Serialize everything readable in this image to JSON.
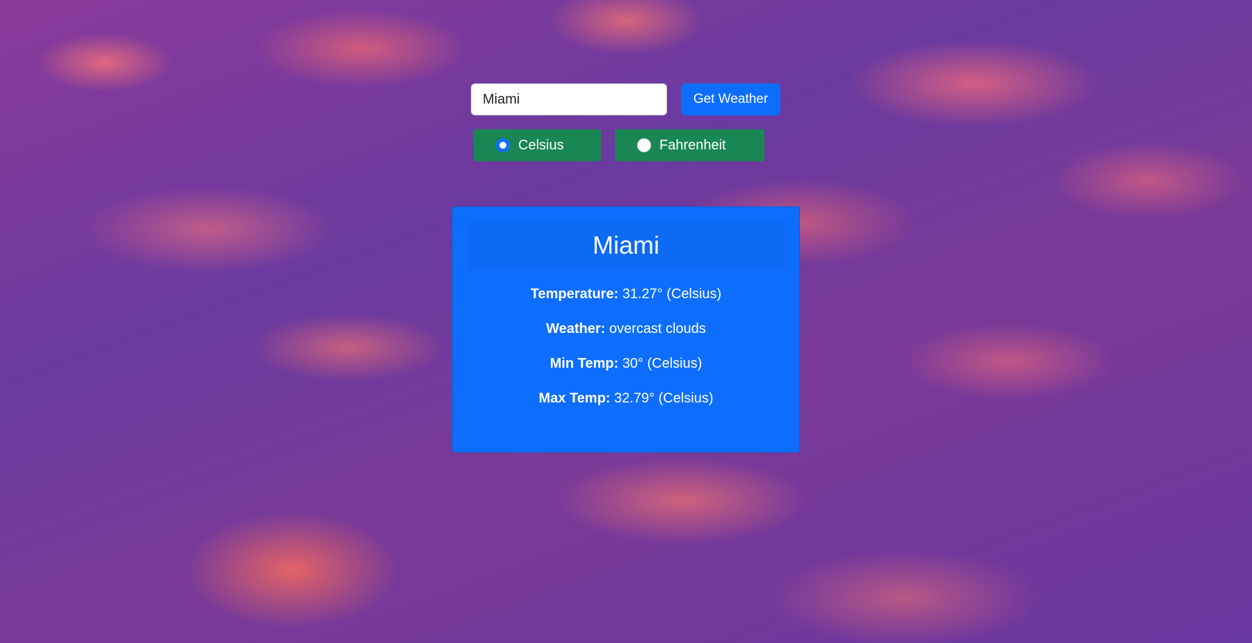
{
  "search": {
    "value": "Miami",
    "button_label": "Get Weather"
  },
  "units": {
    "celsius_label": "Celsius",
    "fahrenheit_label": "Fahrenheit",
    "selected": "Celsius"
  },
  "result": {
    "city": "Miami",
    "temperature_label": "Temperature:",
    "temperature_value": "31.27° (Celsius)",
    "weather_label": "Weather:",
    "weather_value": "overcast clouds",
    "min_label": "Min Temp:",
    "min_value": "30° (Celsius)",
    "max_label": "Max Temp:",
    "max_value": "32.79° (Celsius)"
  },
  "colors": {
    "primary": "#0d6efd",
    "success": "#198754"
  }
}
